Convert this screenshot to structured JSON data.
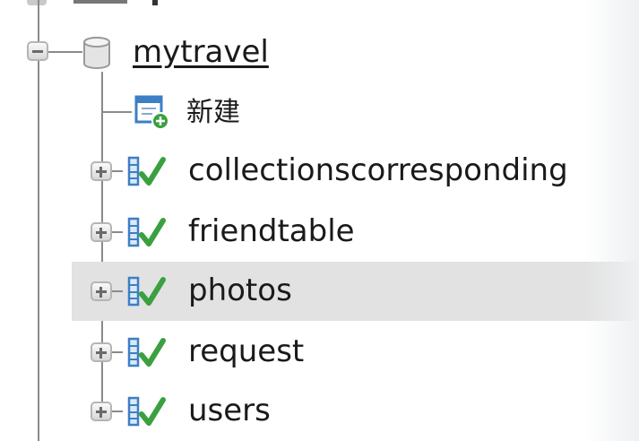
{
  "tree": {
    "database": {
      "name": "mytravel",
      "expanded": true,
      "icon": "database-icon"
    },
    "new_item": {
      "label": "新建",
      "icon": "new-table-icon"
    },
    "tables": [
      {
        "label": "collectionscorresponding",
        "icon": "table-icon",
        "expandable": true,
        "selected": false
      },
      {
        "label": "friendtable",
        "icon": "table-icon",
        "expandable": true,
        "selected": false
      },
      {
        "label": "photos",
        "icon": "table-icon",
        "expandable": true,
        "selected": true
      },
      {
        "label": "request",
        "icon": "table-icon",
        "expandable": true,
        "selected": false
      },
      {
        "label": "users",
        "icon": "table-icon",
        "expandable": true,
        "selected": false
      }
    ]
  },
  "colors": {
    "selected_row": "#e2e2e2",
    "tree_line": "#8a8a8a",
    "table_icon_check": "#3aa040",
    "table_icon_blue": "#3c7fc4"
  }
}
